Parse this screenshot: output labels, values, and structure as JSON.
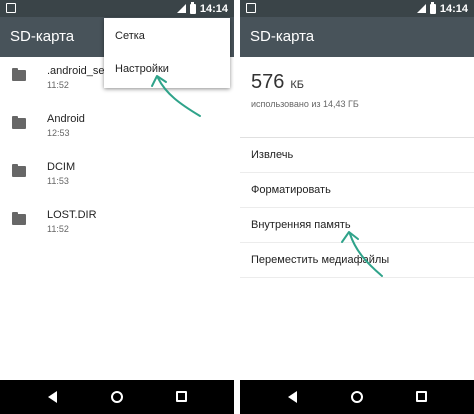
{
  "left_screen": {
    "status_time": "14:14",
    "title": "SD-карта",
    "files": [
      {
        "name": ".android_sec",
        "time": "11:52"
      },
      {
        "name": "Android",
        "time": "12:53"
      },
      {
        "name": "DCIM",
        "time": "11:53"
      },
      {
        "name": "LOST.DIR",
        "time": "11:52"
      }
    ],
    "menu": {
      "items": [
        "Сетка",
        "Настройки"
      ]
    }
  },
  "right_screen": {
    "status_time": "14:14",
    "title": "SD-карта",
    "storage": {
      "used": "576",
      "unit": "КБ",
      "description": "использовано из 14,43 ГБ"
    },
    "actions": [
      "Извлечь",
      "Форматировать",
      "Внутренняя память",
      "Переместить медиафайлы"
    ]
  },
  "colors": {
    "status_bar": "#3a4448",
    "app_bar": "#48535a",
    "arrow": "#2fa38a"
  },
  "icons": {
    "folder": "folder-icon",
    "back": "back-triangle-icon",
    "home": "home-circle-icon",
    "recents": "recents-square-icon"
  }
}
